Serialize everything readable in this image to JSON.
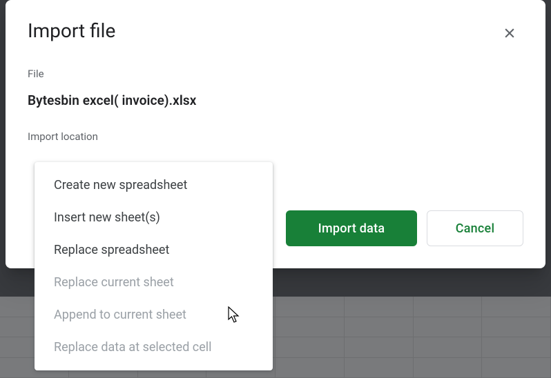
{
  "dialog": {
    "title": "Import file",
    "file_label": "File",
    "file_name": "Bytesbin excel( invoice).xlsx",
    "location_label": "Import location",
    "import_button": "Import data",
    "cancel_button": "Cancel"
  },
  "dropdown": {
    "options": [
      {
        "label": "Create new spreadsheet",
        "enabled": true
      },
      {
        "label": "Insert new sheet(s)",
        "enabled": true
      },
      {
        "label": "Replace spreadsheet",
        "enabled": true
      },
      {
        "label": "Replace current sheet",
        "enabled": false
      },
      {
        "label": "Append to current sheet",
        "enabled": false
      },
      {
        "label": "Replace data at selected cell",
        "enabled": false
      }
    ]
  }
}
